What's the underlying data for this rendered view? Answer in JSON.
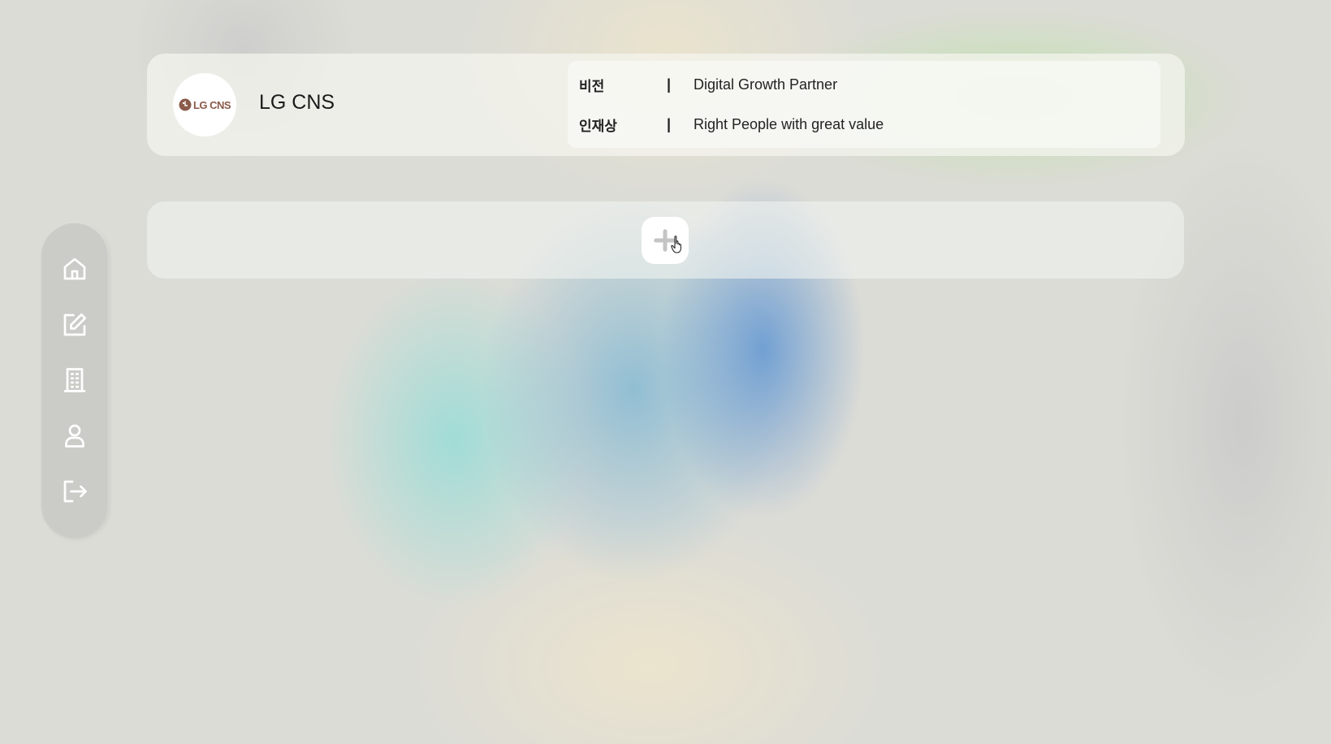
{
  "company": {
    "logo_text": "LG CNS",
    "name": "LG CNS",
    "info": [
      {
        "key": "비전",
        "separator": "|",
        "value": "Digital Growth Partner"
      },
      {
        "key": "인재상",
        "separator": "|",
        "value": "Right People with great value"
      }
    ]
  },
  "sidebar": {
    "items": [
      {
        "icon": "home-icon"
      },
      {
        "icon": "edit-icon"
      },
      {
        "icon": "building-icon"
      },
      {
        "icon": "user-icon"
      },
      {
        "icon": "logout-icon"
      }
    ]
  },
  "add": {
    "icon": "plus-icon"
  },
  "colors": {
    "logo_brand": "#8a5a4a",
    "icon": "#ffffff"
  }
}
